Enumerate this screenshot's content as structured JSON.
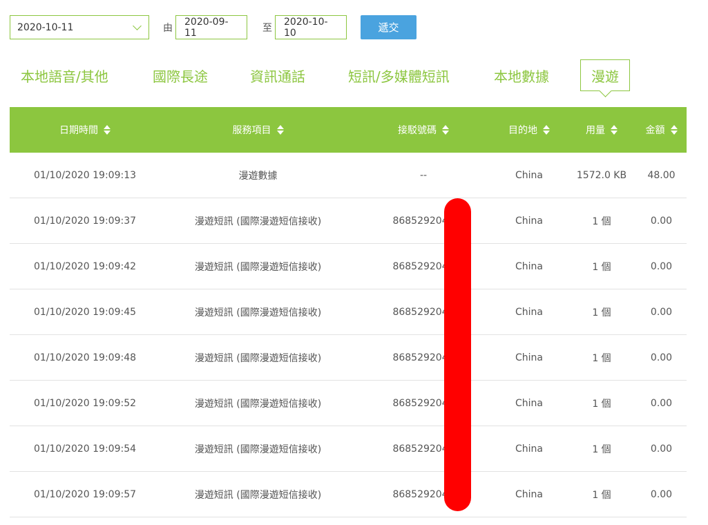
{
  "filter": {
    "period_value": "2020-10-11",
    "from_label": "由",
    "from_date": "2020-09-11",
    "to_label": "至",
    "to_date": "2020-10-10",
    "submit_label": "遞交"
  },
  "tabs": [
    {
      "label": "本地語音/其他",
      "active": false
    },
    {
      "label": "國際長途",
      "active": false
    },
    {
      "label": "資訊通話",
      "active": false
    },
    {
      "label": "短訊/多媒體短訊",
      "active": false
    },
    {
      "label": "本地數據",
      "active": false
    },
    {
      "label": "漫遊",
      "active": true
    }
  ],
  "table": {
    "headers": [
      "日期時間",
      "服務項目",
      "接駁號碼",
      "目的地",
      "用量",
      "金額"
    ],
    "rows": [
      [
        "01/10/2020 19:09:13",
        "漫遊數據",
        "--",
        "China",
        "1572.0 KB",
        "48.00"
      ],
      [
        "01/10/2020 19:09:37",
        "漫遊短訊 (國際漫遊短信接收)",
        "8685292040",
        "China",
        "1 個",
        "0.00"
      ],
      [
        "01/10/2020 19:09:42",
        "漫遊短訊 (國際漫遊短信接收)",
        "8685292040",
        "China",
        "1 個",
        "0.00"
      ],
      [
        "01/10/2020 19:09:45",
        "漫遊短訊 (國際漫遊短信接收)",
        "8685292040",
        "China",
        "1 個",
        "0.00"
      ],
      [
        "01/10/2020 19:09:48",
        "漫遊短訊 (國際漫遊短信接收)",
        "8685292040",
        "China",
        "1 個",
        "0.00"
      ],
      [
        "01/10/2020 19:09:52",
        "漫遊短訊 (國際漫遊短信接收)",
        "8685292040",
        "China",
        "1 個",
        "0.00"
      ],
      [
        "01/10/2020 19:09:54",
        "漫遊短訊 (國際漫遊短信接收)",
        "8685292040",
        "China",
        "1 個",
        "0.00"
      ],
      [
        "01/10/2020 19:09:57",
        "漫遊短訊 (國際漫遊短信接收)",
        "8685292040",
        "China",
        "1 個",
        "0.00"
      ]
    ]
  },
  "colors": {
    "accent_green": "#8cc63f",
    "submit_blue": "#4aa3df",
    "redaction_red": "#ff0000"
  },
  "icons": {
    "period_dropdown": "chevron-down-icon",
    "sort": "sort-arrows-icon"
  }
}
